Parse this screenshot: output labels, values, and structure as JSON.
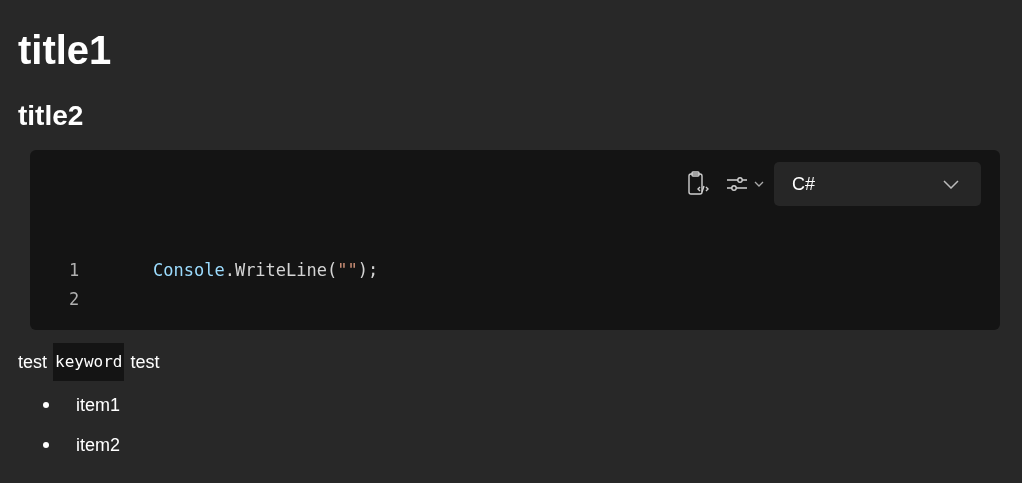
{
  "title1": "title1",
  "title2": "title2",
  "code_block": {
    "language": "C#",
    "lines": [
      {
        "number": "1",
        "tokens": [
          {
            "kind": "type",
            "text": "Console"
          },
          {
            "kind": "plain",
            "text": ".WriteLine("
          },
          {
            "kind": "string",
            "text": "\"\""
          },
          {
            "kind": "plain",
            "text": ");"
          }
        ]
      },
      {
        "number": "2"
      }
    ]
  },
  "paragraph": [
    {
      "kind": "text",
      "text": "test"
    },
    {
      "kind": "code",
      "text": "keyword"
    },
    {
      "kind": "text",
      "text": "test"
    }
  ],
  "list": [
    "item1",
    "item2"
  ]
}
